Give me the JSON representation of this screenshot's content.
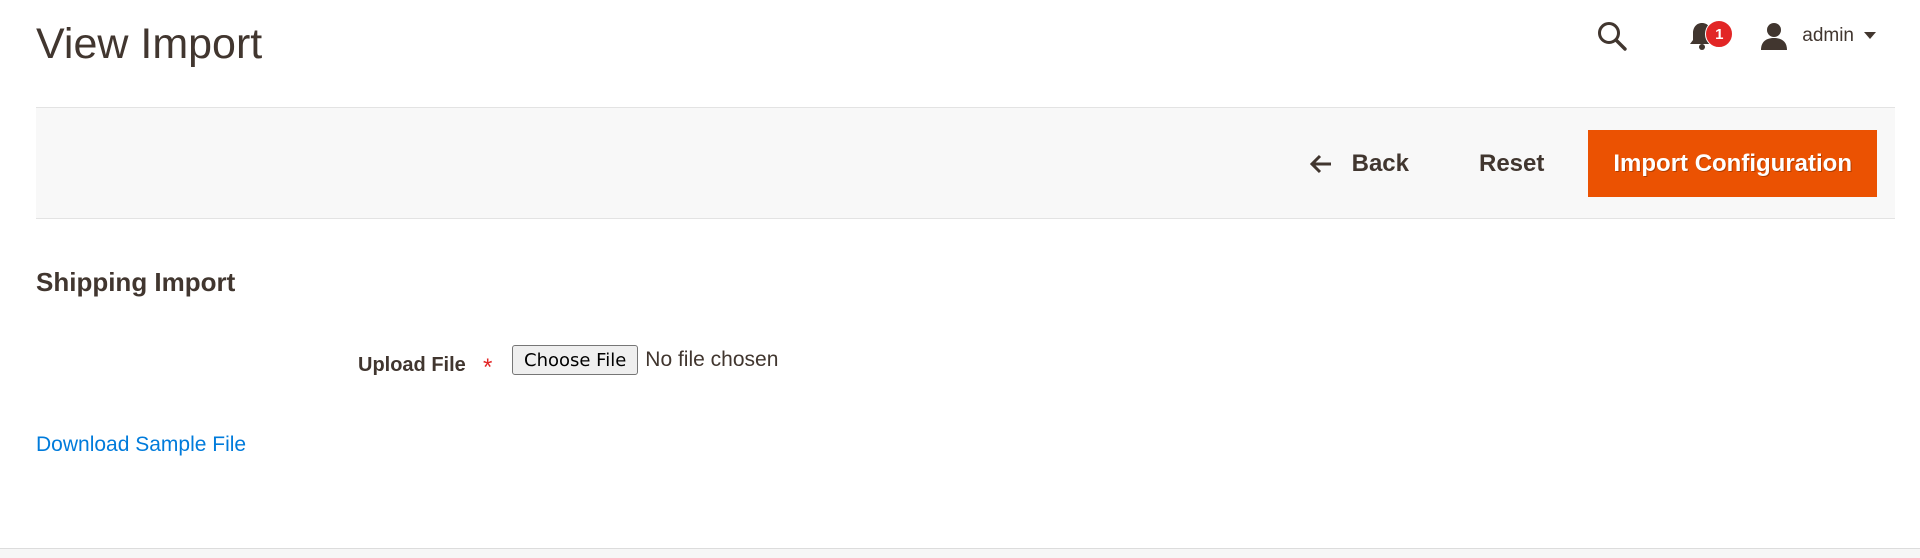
{
  "header": {
    "title": "View Import",
    "search_icon": "search-icon",
    "notifications_icon": "bell-icon",
    "notifications_count": "1",
    "notification_badge_color": "#e22626",
    "user_icon": "user-icon",
    "user_name": "admin",
    "user_menu_icon": "caret-down-icon"
  },
  "toolbar": {
    "back_icon": "arrow-left-icon",
    "back_label": "Back",
    "reset_label": "Reset",
    "primary_label": "Import Configuration",
    "primary_color": "#eb5202"
  },
  "section": {
    "title": "Shipping Import"
  },
  "upload_field": {
    "label": "Upload File",
    "required_marker": "*",
    "button_label": "Choose File",
    "status": "No file chosen"
  },
  "download_link": {
    "label": "Download Sample File",
    "color": "#007bdb"
  }
}
